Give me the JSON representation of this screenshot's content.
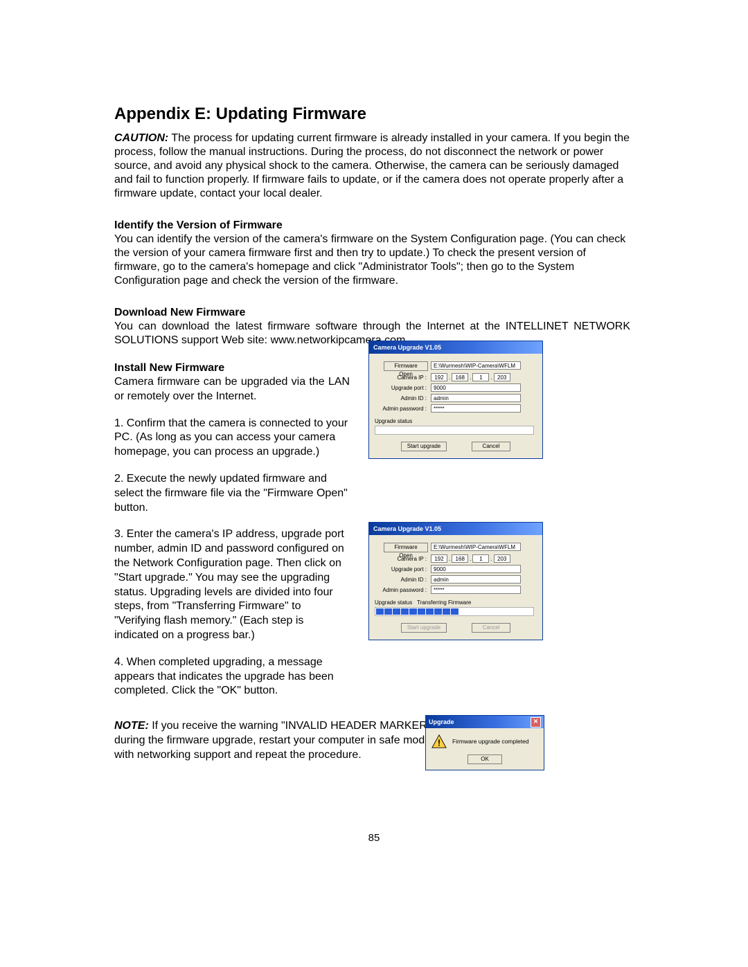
{
  "title": "Appendix E: Updating Firmware",
  "caution_label": "CAUTION:",
  "caution_text": " The process for updating current firmware is already installed in your camera. If you begin the process, follow the manual instructions. During the process, do not disconnect the network or power source, and avoid any physical shock to the camera. Otherwise, the camera can be seriously damaged and fail to function properly. If firmware fails to update, or if the camera does not operate properly after a firmware update, contact your local dealer.",
  "identify_head": "Identify the Version of Firmware",
  "identify_text": "You can identify the version of the camera's firmware on the System Configuration page. (You can check the version of your camera firmware first and then try to update.) To check the present version of firmware, go to the camera's homepage and click \"Administrator Tools\"; then go to the System Configuration page and check the version of the firmware.",
  "download_head": "Download New Firmware",
  "download_text": "You can download the latest firmware software through the Internet at the INTELLINET NETWORK SOLUTIONS support Web site: www.networkipcamera.com.",
  "install_head": "Install New Firmware",
  "install_intro": "Camera firmware can be upgraded via the LAN or remotely over the Internet.",
  "install_step1": "1. Confirm that the camera is connected to your PC. (As long as you can access your camera homepage, you can process an upgrade.)",
  "install_step2": "2. Execute the newly updated firmware and select the firmware file via the \"Firmware Open\" button.",
  "install_step3": "3. Enter the camera's IP address, upgrade port number, admin ID and password configured on the Network Configuration page. Then click on \"Start upgrade.\" You may see the upgrading status. Upgrading levels are divided into four steps, from \"Transferring Firmware\" to \"Verifying flash memory.\" (Each step is indicated on a progress bar.)",
  "install_step4": "4. When completed upgrading, a message appears that indicates the upgrade has been completed. Click the \"OK\" button.",
  "note_label": "NOTE:",
  "note_text": " If you receive the warning \"INVALID HEADER MARKER\" during the firmware upgrade, restart your computer in safe mode with networking support and repeat the procedure.",
  "page_number": "85",
  "dialog": {
    "title": "Camera Upgrade V1.05",
    "firmware_open_btn": "Firmware Open",
    "firmware_path": "E:\\Wurmesh\\WIP-Camera\\WFLM",
    "camera_ip_label": "Camera IP :",
    "ip": [
      "192",
      "168",
      "1",
      "203"
    ],
    "upgrade_port_label": "Upgrade port :",
    "upgrade_port": "9000",
    "admin_id_label": "Admin ID :",
    "admin_id": "admin",
    "admin_pw_label": "Admin password :",
    "admin_pw": "*****",
    "status_label": "Upgrade status",
    "status_transferring": "Transferring Firmware",
    "start_btn": "Start upgrade",
    "cancel_btn": "Cancel"
  },
  "popup": {
    "title": "Upgrade",
    "msg": "Firmware upgrade completed",
    "ok": "OK"
  }
}
